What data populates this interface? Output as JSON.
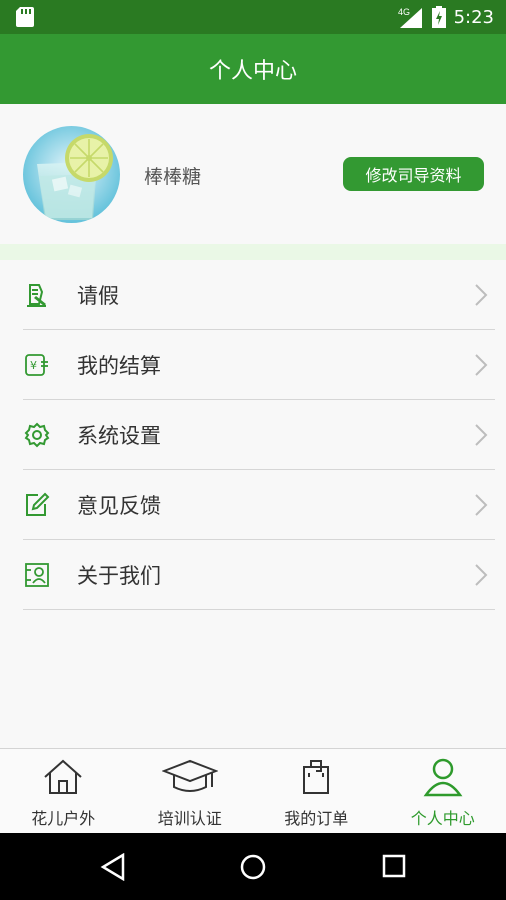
{
  "status_bar": {
    "network": "4G",
    "time": "5:23"
  },
  "app_bar": {
    "title": "个人中心"
  },
  "profile": {
    "username": "棒棒糖",
    "edit_button": "修改司导资料"
  },
  "menu": [
    {
      "label": "请假",
      "icon": "leave-request-icon"
    },
    {
      "label": "我的结算",
      "icon": "settlement-icon"
    },
    {
      "label": "系统设置",
      "icon": "gear-icon"
    },
    {
      "label": "意见反馈",
      "icon": "edit-feedback-icon"
    },
    {
      "label": "关于我们",
      "icon": "contact-card-icon"
    }
  ],
  "bottom_nav": [
    {
      "label": "花儿户外",
      "icon": "home-icon",
      "active": false
    },
    {
      "label": "培训认证",
      "icon": "graduation-cap-icon",
      "active": false
    },
    {
      "label": "我的订单",
      "icon": "order-bag-icon",
      "active": false
    },
    {
      "label": "个人中心",
      "icon": "person-icon",
      "active": true
    }
  ],
  "colors": {
    "primary": "#339932",
    "status_bar": "#2a7a22",
    "active": "#2e9a2c",
    "band": "#eaf8e6"
  }
}
